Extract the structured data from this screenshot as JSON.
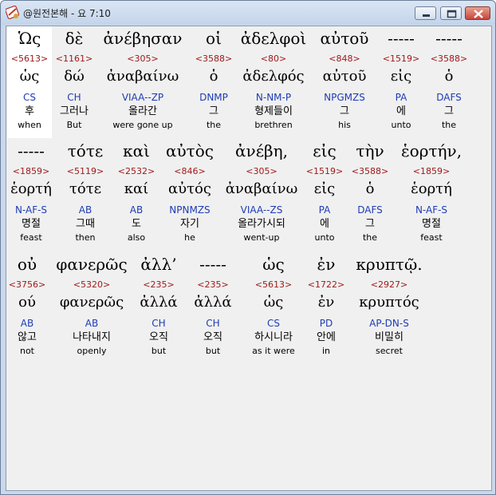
{
  "window": {
    "title": "@원전본해 - 요 7:10",
    "icons": {
      "app": "bible-app-icon",
      "minimize": "minimize-icon",
      "maximize": "maximize-icon",
      "close": "close-icon"
    }
  },
  "rows": [
    [
      {
        "greek": "Ὡς",
        "strong": "<5613>",
        "lemma": "ὡς",
        "parse": "CS",
        "korean": "후",
        "english": "when"
      },
      {
        "greek": "δὲ",
        "strong": "<1161>",
        "lemma": "δώ",
        "parse": "CH",
        "korean": "그러나",
        "english": "But"
      },
      {
        "greek": "ἀνέβησαν",
        "strong": "<305>",
        "lemma": "ἀναβαίνω",
        "parse": "VIAA--ZP",
        "korean": "올라간",
        "english": "were gone up"
      },
      {
        "greek": "οἱ",
        "strong": "<3588>",
        "lemma": "ὁ",
        "parse": "DNMP",
        "korean": "그",
        "english": "the"
      },
      {
        "greek": "ἀδελφοὶ",
        "strong": "<80>",
        "lemma": "ἀδελφός",
        "parse": "N-NM-P",
        "korean": "형제들이",
        "english": "brethren"
      },
      {
        "greek": "αὐτοῦ",
        "strong": "<848>",
        "lemma": "αὐτοῦ",
        "parse": "NPGMZS",
        "korean": "그",
        "english": "his"
      },
      {
        "greek": "-----",
        "strong": "<1519>",
        "lemma": "εἰς",
        "parse": "PA",
        "korean": "에",
        "english": "unto"
      },
      {
        "greek": "-----",
        "strong": "<3588>",
        "lemma": "ὁ",
        "parse": "DAFS",
        "korean": "그",
        "english": "the"
      }
    ],
    [
      {
        "greek": "-----",
        "strong": "<1859>",
        "lemma": "ἑορτή",
        "parse": "N-AF-S",
        "korean": "명절",
        "english": "feast"
      },
      {
        "greek": "τότε",
        "strong": "<5119>",
        "lemma": "τότε",
        "parse": "AB",
        "korean": "그때",
        "english": "then"
      },
      {
        "greek": "καὶ",
        "strong": "<2532>",
        "lemma": "καί",
        "parse": "AB",
        "korean": "도",
        "english": "also"
      },
      {
        "greek": "αὐτὸς",
        "strong": "<846>",
        "lemma": "αὐτός",
        "parse": "NPNMZS",
        "korean": "자기",
        "english": "he"
      },
      {
        "greek": "ἀνέβη,",
        "strong": "<305>",
        "lemma": "ἀναβαίνω",
        "parse": "VIAA--ZS",
        "korean": "올라가시되",
        "english": "went-up"
      },
      {
        "greek": "εἰς",
        "strong": "<1519>",
        "lemma": "εἰς",
        "parse": "PA",
        "korean": "에",
        "english": "unto"
      },
      {
        "greek": "τὴν",
        "strong": "<3588>",
        "lemma": "ὁ",
        "parse": "DAFS",
        "korean": "그",
        "english": "the"
      },
      {
        "greek": "ἑορτήν,",
        "strong": "<1859>",
        "lemma": "ἑορτή",
        "parse": "N-AF-S",
        "korean": "명절",
        "english": "feast"
      }
    ],
    [
      {
        "greek": "οὐ",
        "strong": "<3756>",
        "lemma": "ού",
        "parse": "AB",
        "korean": "않고",
        "english": "not"
      },
      {
        "greek": "φανερῶς",
        "strong": "<5320>",
        "lemma": "φανερῶς",
        "parse": "AB",
        "korean": "나타내지",
        "english": "openly"
      },
      {
        "greek": "ἀλλ’",
        "strong": "<235>",
        "lemma": "ἀλλά",
        "parse": "CH",
        "korean": "오직",
        "english": "but"
      },
      {
        "greek": "-----",
        "strong": "<235>",
        "lemma": "ἀλλά",
        "parse": "CH",
        "korean": "오직",
        "english": "but"
      },
      {
        "greek": "ὡς",
        "strong": "<5613>",
        "lemma": "ὡς",
        "parse": "CS",
        "korean": "하시니라",
        "english": "as it were"
      },
      {
        "greek": "ἐν",
        "strong": "<1722>",
        "lemma": "ἐν",
        "parse": "PD",
        "korean": "안에",
        "english": "in"
      },
      {
        "greek": "κρυπτῷ.",
        "strong": "<2927>",
        "lemma": "κρυπτός",
        "parse": "AP-DN-S",
        "korean": "비밀히",
        "english": "secret"
      }
    ]
  ]
}
